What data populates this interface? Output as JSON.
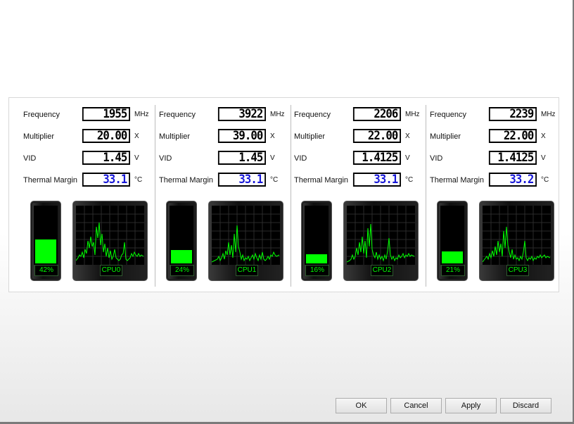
{
  "labels": {
    "frequency": "Frequency",
    "multiplier": "Multiplier",
    "vid": "VID",
    "thermal_margin": "Thermal Margin"
  },
  "units": {
    "frequency": "MHz",
    "multiplier": "X",
    "vid": "V",
    "thermal_margin": "°C"
  },
  "cpus": [
    {
      "name": "CPU0",
      "frequency": "1955",
      "multiplier": "20.00",
      "vid": "1.45",
      "thermal_margin": "33.1",
      "load_text": "42%",
      "load_fraction": 0.42
    },
    {
      "name": "CPU1",
      "frequency": "3922",
      "multiplier": "39.00",
      "vid": "1.45",
      "thermal_margin": "33.1",
      "load_text": "24%",
      "load_fraction": 0.24
    },
    {
      "name": "CPU2",
      "frequency": "2206",
      "multiplier": "22.00",
      "vid": "1.4125",
      "thermal_margin": "33.1",
      "load_text": "16%",
      "load_fraction": 0.16
    },
    {
      "name": "CPU3",
      "frequency": "2239",
      "multiplier": "22.00",
      "vid": "1.4125",
      "thermal_margin": "33.2",
      "load_text": "21%",
      "load_fraction": 0.21
    }
  ],
  "buttons": {
    "ok": "OK",
    "cancel": "Cancel",
    "apply": "Apply",
    "discard": "Discard"
  },
  "colors": {
    "load_green": "#00ff00",
    "thermal_blue": "#1818d8"
  }
}
